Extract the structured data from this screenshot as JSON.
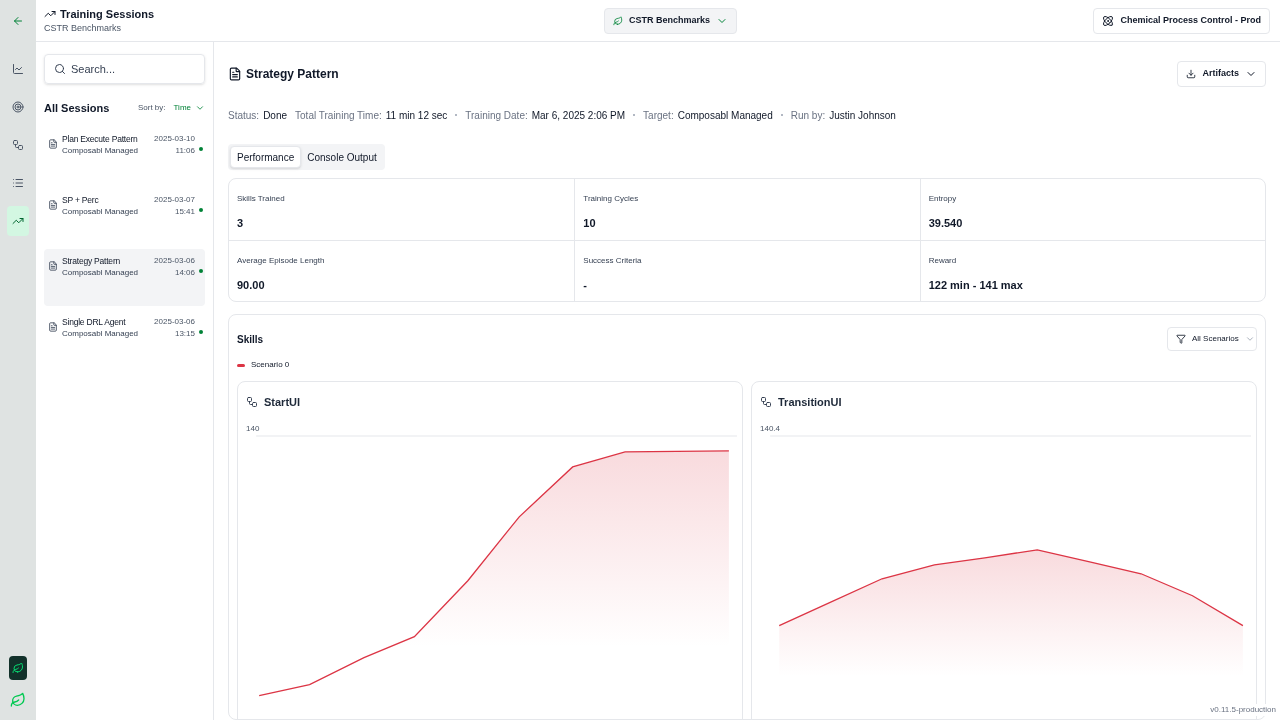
{
  "header": {
    "title": "Training Sessions",
    "subtitle": "CSTR Benchmarks",
    "project_picker": "CSTR Benchmarks",
    "workspace": "Chemical Process Control - Prod"
  },
  "rail": [
    {
      "selected": false
    },
    {
      "selected": false
    },
    {
      "selected": false
    },
    {
      "selected": false
    },
    {
      "selected": true
    }
  ],
  "sidebar": {
    "search": {
      "placeholder": "Search..."
    },
    "heading": "All Sessions",
    "sort_label": "Sort by:",
    "sort_value": "Time",
    "sessions": [
      {
        "name": "Plan Execute Pattern",
        "target": "Composabl Managed",
        "date": "2025-03-10",
        "time": "11:06",
        "selected": false
      },
      {
        "name": "SP + Perc",
        "target": "Composabl Managed",
        "date": "2025-03-07",
        "time": "15:41",
        "selected": false
      },
      {
        "name": "Strategy Pattern",
        "target": "Composabl Managed",
        "date": "2025-03-06",
        "time": "14:06",
        "selected": true
      },
      {
        "name": "Single DRL Agent",
        "target": "Composabl Managed",
        "date": "2025-03-06",
        "time": "13:15",
        "selected": false
      }
    ]
  },
  "main": {
    "title": "Strategy Pattern",
    "artifacts": "Artifacts",
    "meta": [
      {
        "label": "Status:",
        "value": "Done"
      },
      {
        "label": "Total Training Time:",
        "value": "11 min 12 sec"
      },
      {
        "label": "Training Date:",
        "value": "Mar 6, 2025 2:06 PM"
      },
      {
        "label": "Target:",
        "value": "Composabl Managed"
      },
      {
        "label": "Run by:",
        "value": "Justin Johnson"
      }
    ],
    "tabs": [
      {
        "label": "Performance",
        "selected": true
      },
      {
        "label": "Console Output",
        "selected": false
      }
    ],
    "stats": [
      {
        "label": "Skills Trained",
        "value": "3"
      },
      {
        "label": "Training Cycles",
        "value": "10"
      },
      {
        "label": "Entropy",
        "value": "39.540"
      },
      {
        "label": "Average Episode Length",
        "value": "90.00"
      },
      {
        "label": "Success Criteria",
        "value": "-"
      },
      {
        "label": "Reward",
        "value": "122 min - 141 max"
      }
    ],
    "skills": {
      "title": "Skills",
      "filter": "All Scenarios",
      "legend": [
        {
          "name": "Scenario 0",
          "color": "#dc3545"
        }
      ],
      "charts": [
        {
          "name": "StartUI",
          "top_tick": "140"
        },
        {
          "name": "TransitionUI",
          "top_tick": "140.4"
        }
      ]
    }
  },
  "version": "v0.11.5-production"
}
